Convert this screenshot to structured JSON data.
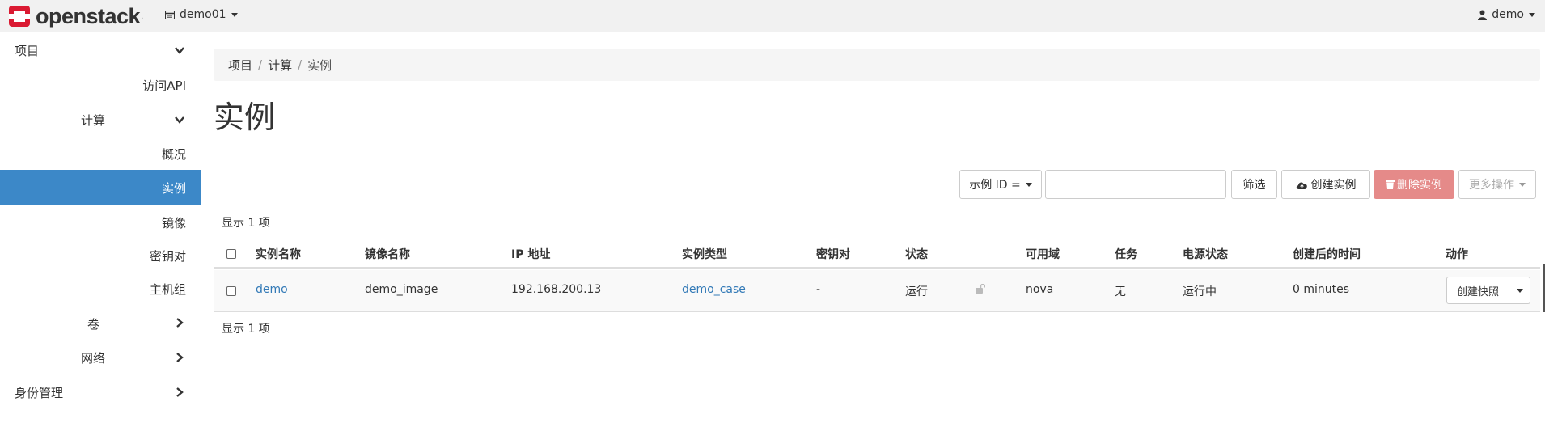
{
  "navbar": {
    "brand": "openstack",
    "brand_reg": ".",
    "project": "demo01",
    "user": "demo"
  },
  "sidebar": {
    "project": "项目",
    "api_access": "访问API",
    "compute": "计算",
    "overview": "概况",
    "instances": "实例",
    "images": "镜像",
    "keypairs": "密钥对",
    "host_groups": "主机组",
    "volumes": "卷",
    "network": "网络",
    "identity": "身份管理"
  },
  "breadcrumb": [
    "项目",
    "计算",
    "实例"
  ],
  "page_title": "实例",
  "toolbar": {
    "filter_select": "示例 ID =",
    "filter_value": "",
    "filter_button": "筛选",
    "create_button": "创建实例",
    "delete_button": "删除实例",
    "more_button": "更多操作"
  },
  "count_text": "显示 1 项",
  "table": {
    "columns": [
      "实例名称",
      "镜像名称",
      "IP 地址",
      "实例类型",
      "密钥对",
      "状态",
      "可用域",
      "任务",
      "电源状态",
      "创建后的时间",
      "动作"
    ],
    "rows": [
      {
        "name": "demo",
        "image": "demo_image",
        "ip": "192.168.200.13",
        "flavor": "demo_case",
        "keypair": "-",
        "status": "运行",
        "zone": "nova",
        "task": "无",
        "power": "运行中",
        "age": "0 minutes",
        "action": "创建快照"
      }
    ]
  },
  "colors": {
    "accent": "#3c88c8",
    "danger": "#e58a89",
    "link": "#337ab7",
    "logo_red": "#da1a32"
  }
}
